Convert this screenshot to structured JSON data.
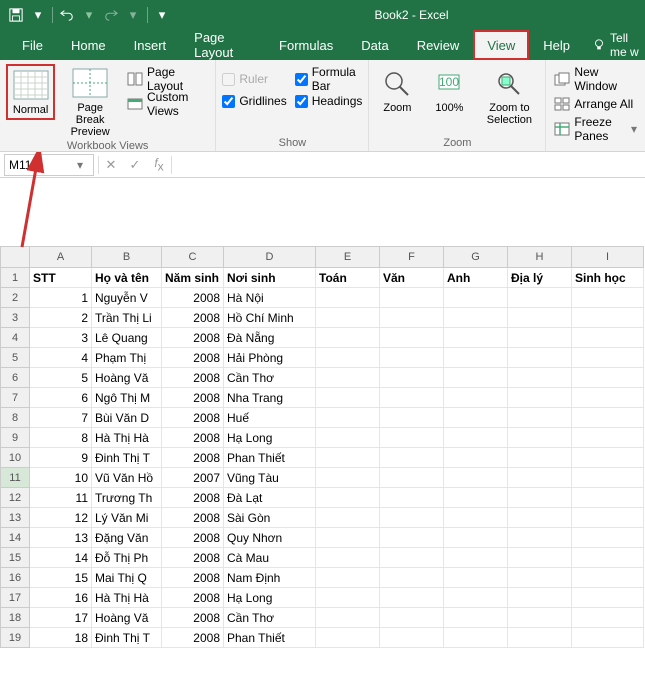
{
  "title": "Book2  -  Excel",
  "qat": {
    "save": "save-icon",
    "undo": "undo-icon",
    "redo": "redo-icon"
  },
  "menu": {
    "items": [
      "File",
      "Home",
      "Insert",
      "Page Layout",
      "Formulas",
      "Data",
      "Review",
      "View",
      "Help"
    ],
    "active": "View",
    "tellme": "Tell me w"
  },
  "ribbon": {
    "workbook_views": {
      "label": "Workbook Views",
      "normal": "Normal",
      "page_break": "Page Break\nPreview",
      "page_layout": "Page Layout",
      "custom_views": "Custom Views"
    },
    "show": {
      "label": "Show",
      "ruler": "Ruler",
      "gridlines": "Gridlines",
      "formula_bar": "Formula Bar",
      "headings": "Headings",
      "ruler_checked": false,
      "gridlines_checked": true,
      "formula_bar_checked": true,
      "headings_checked": true
    },
    "zoom": {
      "label": "Zoom",
      "zoom_btn": "Zoom",
      "hundred": "100%",
      "zoom_sel": "Zoom to\nSelection"
    },
    "window": {
      "new_window": "New Window",
      "arrange_all": "Arrange All",
      "freeze_panes": "Freeze Panes"
    }
  },
  "name_box": "M11",
  "columns": [
    "A",
    "B",
    "C",
    "D",
    "E",
    "F",
    "G",
    "H",
    "I"
  ],
  "header_row": [
    "STT",
    "Họ và tên",
    "Năm sinh",
    "Nơi sinh",
    "Toán",
    "Văn",
    "Anh",
    "Địa lý",
    "Sinh học"
  ],
  "rows": [
    {
      "stt": 1,
      "name": "Nguyễn V",
      "year": 2008,
      "place": "Hà Nội"
    },
    {
      "stt": 2,
      "name": "Trần Thị Li",
      "year": 2008,
      "place": "Hồ Chí Minh"
    },
    {
      "stt": 3,
      "name": "Lê Quang",
      "year": 2008,
      "place": "Đà Nẵng"
    },
    {
      "stt": 4,
      "name": "Phạm Thị",
      "year": 2008,
      "place": "Hải Phòng"
    },
    {
      "stt": 5,
      "name": "Hoàng Vă",
      "year": 2008,
      "place": "Cần Thơ"
    },
    {
      "stt": 6,
      "name": "Ngô Thị M",
      "year": 2008,
      "place": "Nha Trang"
    },
    {
      "stt": 7,
      "name": "Bùi Văn D",
      "year": 2008,
      "place": "Huế"
    },
    {
      "stt": 8,
      "name": "Hà Thị Hà",
      "year": 2008,
      "place": "Hạ Long"
    },
    {
      "stt": 9,
      "name": "Đinh Thị T",
      "year": 2008,
      "place": "Phan Thiết"
    },
    {
      "stt": 10,
      "name": "Vũ Văn Hồ",
      "year": 2007,
      "place": "Vũng Tàu"
    },
    {
      "stt": 11,
      "name": "Trương Th",
      "year": 2008,
      "place": "Đà Lạt"
    },
    {
      "stt": 12,
      "name": "Lý Văn Mi",
      "year": 2008,
      "place": "Sài Gòn"
    },
    {
      "stt": 13,
      "name": "Đặng Văn",
      "year": 2008,
      "place": "Quy Nhơn"
    },
    {
      "stt": 14,
      "name": "Đỗ Thị Ph",
      "year": 2008,
      "place": "Cà Mau"
    },
    {
      "stt": 15,
      "name": "Mai Thị Q",
      "year": 2008,
      "place": "Nam Định"
    },
    {
      "stt": 16,
      "name": "Hà Thị Hà",
      "year": 2008,
      "place": "Hạ Long"
    },
    {
      "stt": 17,
      "name": "Hoàng Vă",
      "year": 2008,
      "place": "Cần Thơ"
    },
    {
      "stt": 18,
      "name": "Đinh Thị T",
      "year": 2008,
      "place": "Phan Thiết"
    }
  ],
  "selected_row": 11
}
